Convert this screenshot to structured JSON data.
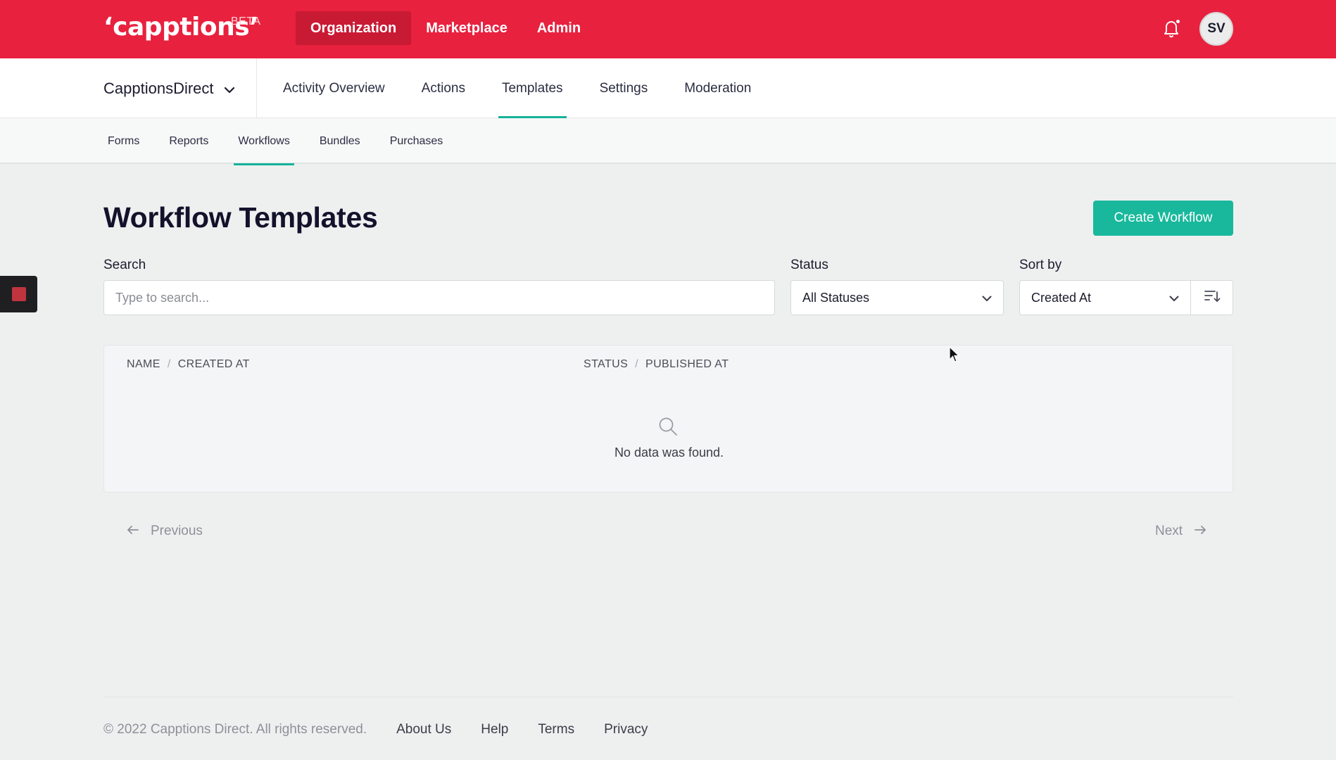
{
  "app": {
    "logo": "‘capptions’",
    "badge": "BETA"
  },
  "topnav": {
    "items": [
      {
        "label": "Organization",
        "active": true
      },
      {
        "label": "Marketplace",
        "active": false
      },
      {
        "label": "Admin",
        "active": false
      }
    ],
    "notifications_icon": "bell-icon",
    "avatar_initials": "SV"
  },
  "org_selector": {
    "value": "CapptionsDirect",
    "icon": "chevron-down-icon"
  },
  "subnav": {
    "items": [
      {
        "label": "Activity Overview",
        "active": false
      },
      {
        "label": "Actions",
        "active": false
      },
      {
        "label": "Templates",
        "active": true
      },
      {
        "label": "Settings",
        "active": false
      },
      {
        "label": "Moderation",
        "active": false
      }
    ]
  },
  "tertnav": {
    "items": [
      {
        "label": "Forms",
        "active": false
      },
      {
        "label": "Reports",
        "active": false
      },
      {
        "label": "Workflows",
        "active": true
      },
      {
        "label": "Bundles",
        "active": false
      },
      {
        "label": "Purchases",
        "active": false
      }
    ]
  },
  "main": {
    "title": "Workflow Templates",
    "create_button": "Create Workflow"
  },
  "filters": {
    "search_label": "Search",
    "search_placeholder": "Type to search...",
    "status_label": "Status",
    "status_value": "All Statuses",
    "sort_label": "Sort by",
    "sort_value": "Created At",
    "sort_direction_icon": "sort-descending-icon"
  },
  "table": {
    "col1_a": "NAME",
    "col1_b": "CREATED AT",
    "col2_a": "STATUS",
    "col2_b": "PUBLISHED AT",
    "separator": "/",
    "empty_text": "No data was found.",
    "empty_icon": "search-icon"
  },
  "pager": {
    "previous": "Previous",
    "next": "Next"
  },
  "footer": {
    "copyright": "© 2022 Capptions Direct. All rights reserved.",
    "links": [
      "About Us",
      "Help",
      "Terms",
      "Privacy"
    ]
  },
  "colors": {
    "brand": "#e8213f",
    "accent": "#19b89c"
  }
}
